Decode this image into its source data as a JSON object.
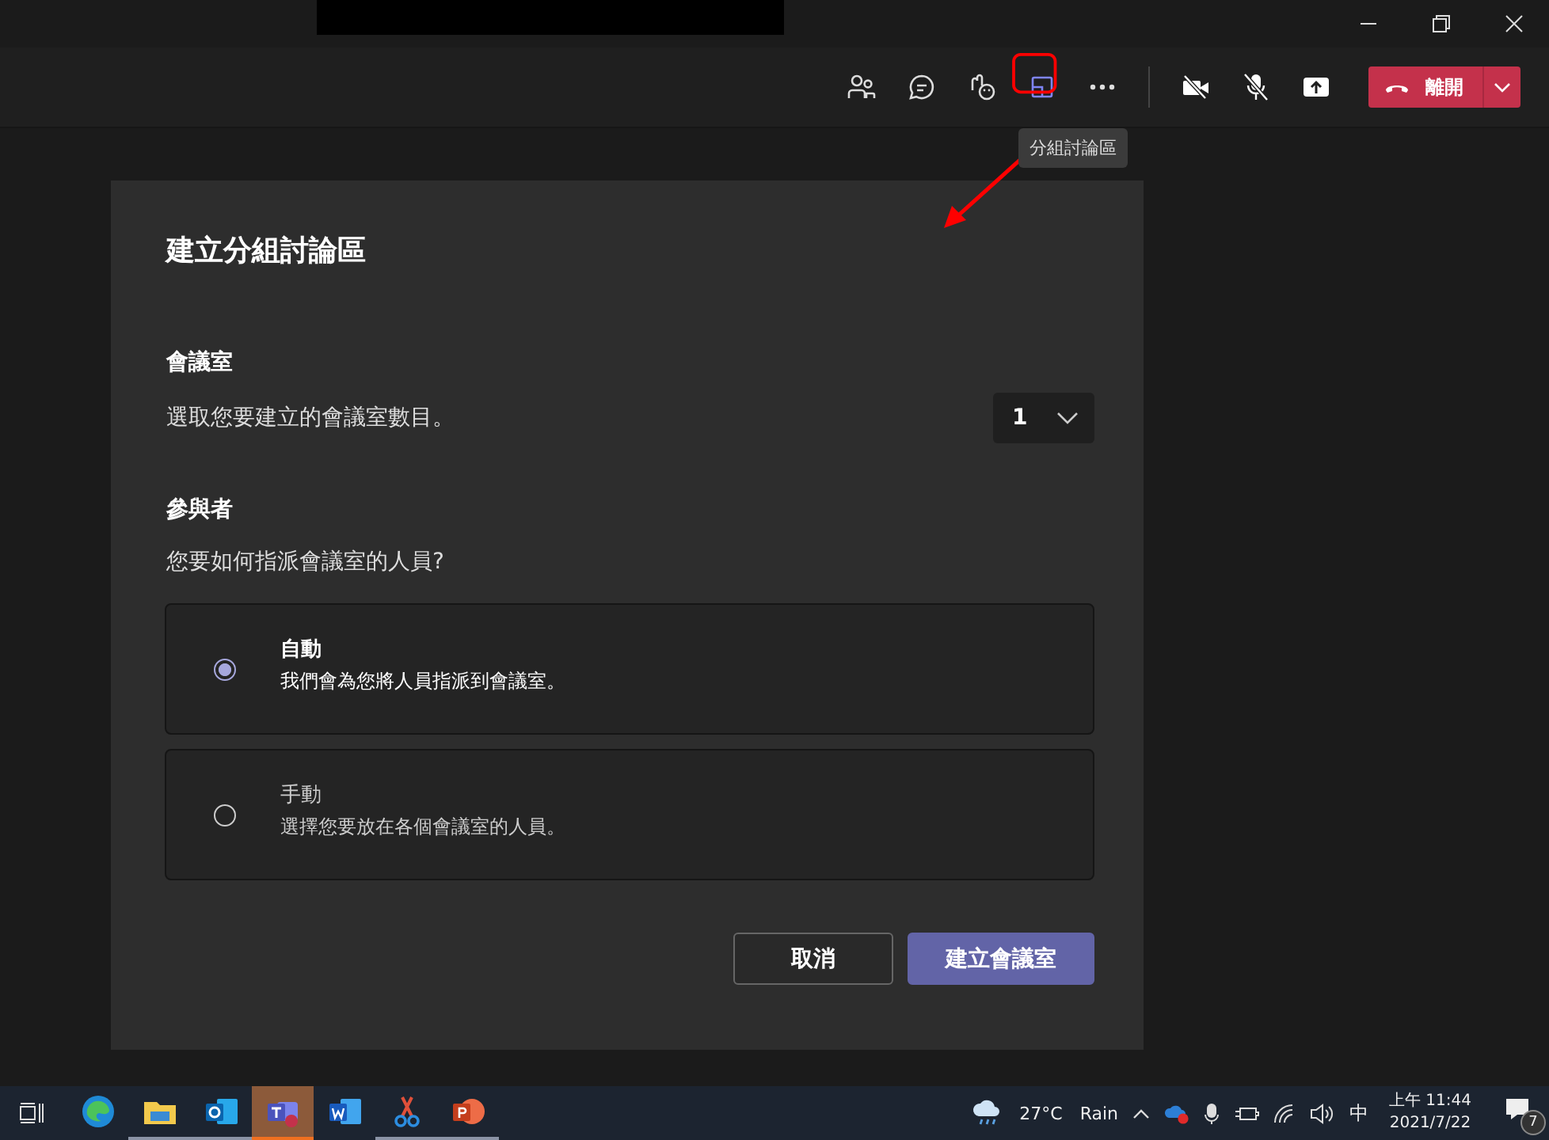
{
  "toolbar": {
    "items": [
      {
        "kind": "people",
        "highlighted": false
      },
      {
        "kind": "chat",
        "highlighted": false
      },
      {
        "kind": "reactions",
        "highlighted": false
      },
      {
        "kind": "breakout",
        "highlighted": true
      },
      {
        "kind": "more",
        "highlighted": false
      }
    ],
    "controls": [
      {
        "kind": "camera-off"
      },
      {
        "kind": "mic-off"
      },
      {
        "kind": "share"
      }
    ],
    "leave_button": {
      "label": "離開"
    },
    "tooltip": "分組討論區"
  },
  "dialog": {
    "title": "建立分組討論區",
    "rooms": {
      "heading": "會議室",
      "prompt": "選取您要建立的會議室數目。",
      "count": "1"
    },
    "participants": {
      "heading": "參與者",
      "prompt": "您要如何指派會議室的人員?",
      "options": [
        {
          "title": "自動",
          "description": "我們會為您將人員指派到會議室。",
          "selected": true
        },
        {
          "title": "手動",
          "description": "選擇您要放在各個會議室的人員。",
          "selected": false
        }
      ]
    },
    "buttons": [
      {
        "label": "取消",
        "kind": "secondary"
      },
      {
        "label": "建立會議室",
        "kind": "primary"
      }
    ]
  },
  "taskbar": {
    "apps": [
      {
        "kind": "edge",
        "active": false,
        "running": false
      },
      {
        "kind": "explorer",
        "active": false,
        "running": true
      },
      {
        "kind": "outlook",
        "active": false,
        "running": true
      },
      {
        "kind": "teams",
        "active": true,
        "running": true
      },
      {
        "kind": "word",
        "active": false,
        "running": false
      },
      {
        "kind": "snip",
        "active": false,
        "running": true
      },
      {
        "kind": "powerpoint",
        "active": false,
        "running": true
      }
    ],
    "tray": {
      "temperature": "27°C",
      "condition": "Rain",
      "ime": "中",
      "time": "上午 11:44",
      "date": "2021/7/22",
      "notifications": "7"
    }
  }
}
